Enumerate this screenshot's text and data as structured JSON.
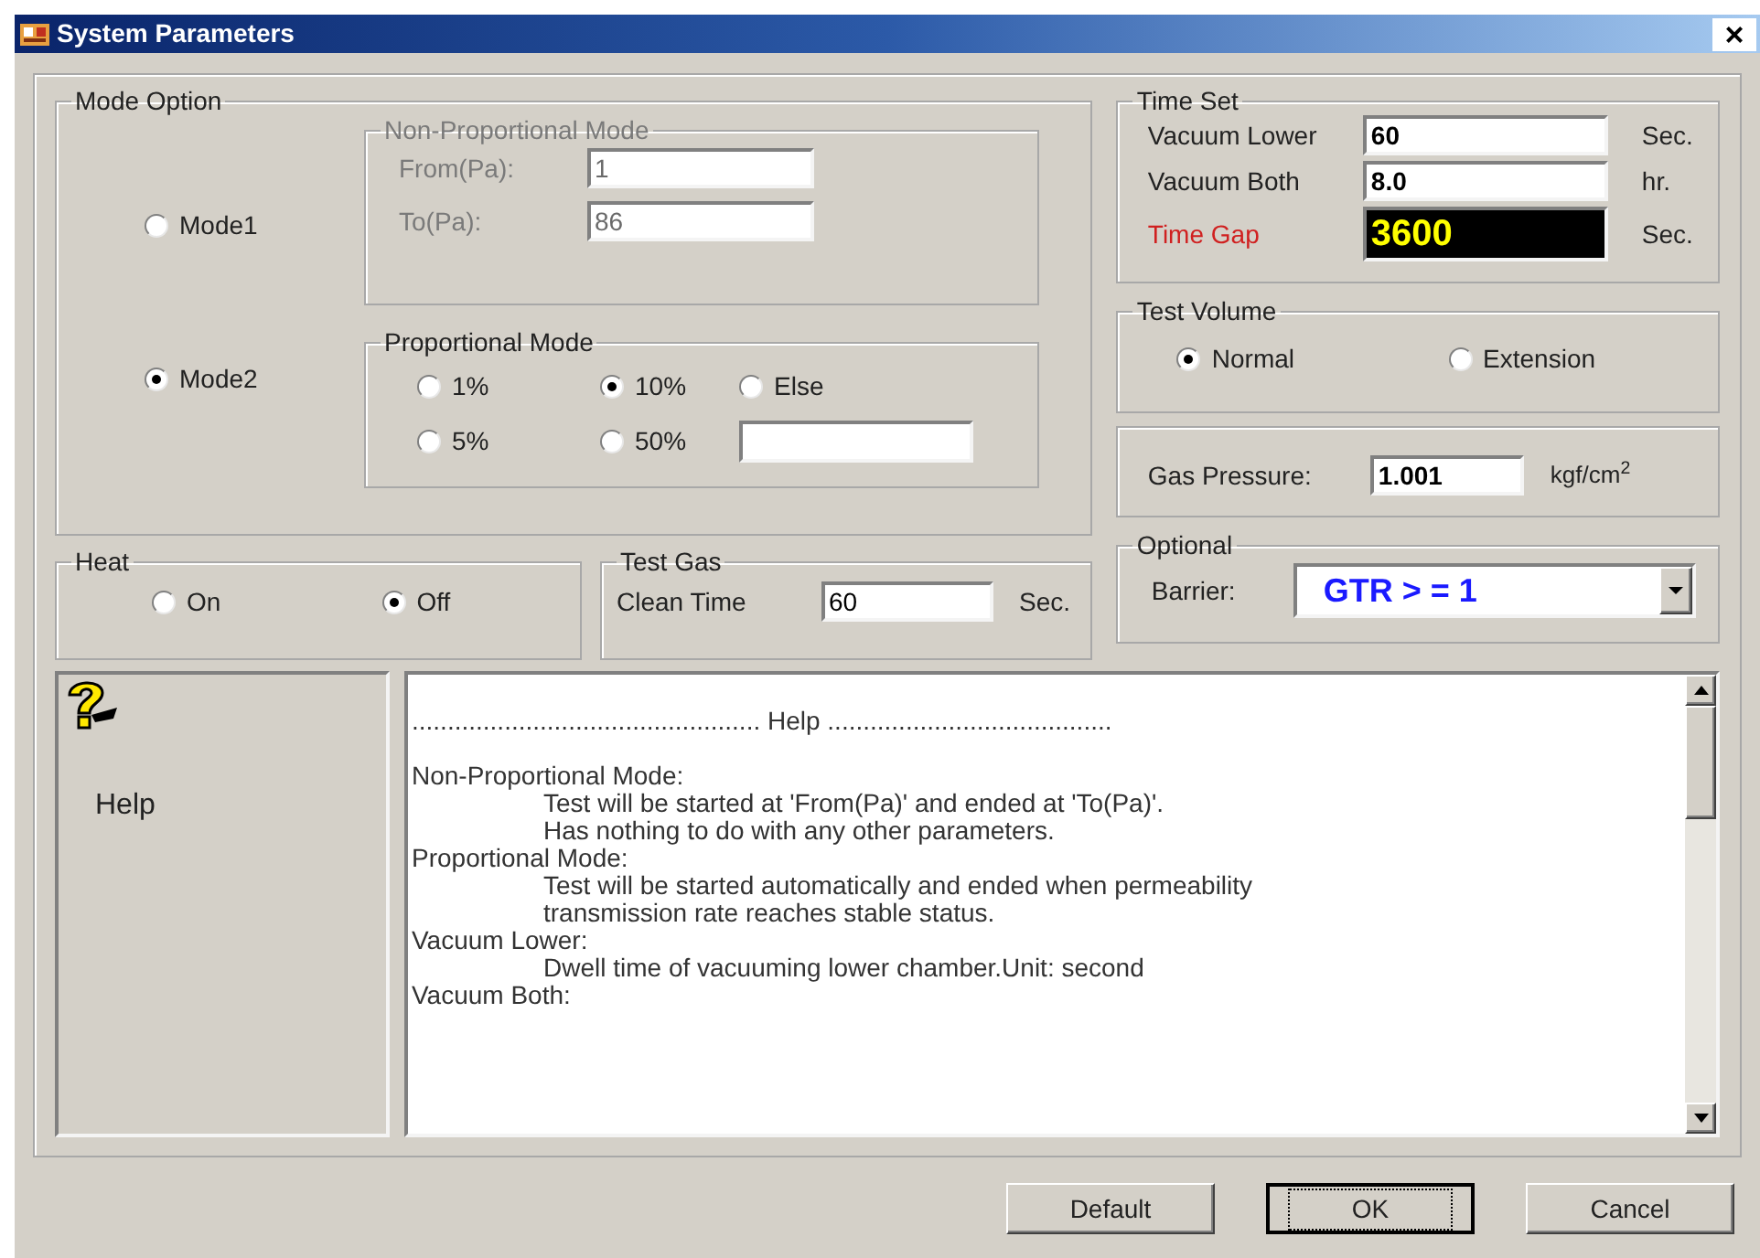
{
  "window": {
    "title": "System Parameters",
    "close": "×"
  },
  "mode_option": {
    "title": "Mode Option",
    "modes": [
      {
        "label": "Mode1",
        "selected": false
      },
      {
        "label": "Mode2",
        "selected": true
      }
    ],
    "non_proportional": {
      "title": "Non-Proportional Mode",
      "disabled": true,
      "fields": [
        {
          "label": "From(Pa):",
          "value": "1"
        },
        {
          "label": "To(Pa):",
          "value": "86"
        }
      ]
    },
    "proportional": {
      "title": "Proportional Mode",
      "options": [
        {
          "label": "1%",
          "selected": false
        },
        {
          "label": "10%",
          "selected": true
        },
        {
          "label": "Else",
          "selected": false
        },
        {
          "label": "5%",
          "selected": false
        },
        {
          "label": "50%",
          "selected": false
        }
      ]
    }
  },
  "heat": {
    "title": "Heat",
    "options": [
      {
        "label": "On",
        "selected": false
      },
      {
        "label": "Off",
        "selected": true
      }
    ]
  },
  "test_gas": {
    "title": "Test Gas",
    "label": "Clean Time",
    "value": "60",
    "unit": "Sec."
  },
  "time_set": {
    "title": "Time Set",
    "rows": [
      {
        "label": "Vacuum Lower",
        "value": "60",
        "unit": "Sec.",
        "kind": "input"
      },
      {
        "label": "Vacuum Both",
        "value": "8.0",
        "unit": "hr.",
        "kind": "input"
      },
      {
        "label": "Time Gap",
        "value": "3600",
        "unit": "Sec.",
        "kind": "display"
      }
    ]
  },
  "test_volume": {
    "title": "Test Volume",
    "options": [
      {
        "label": "Normal",
        "selected": true
      },
      {
        "label": "Extension",
        "selected": false
      }
    ]
  },
  "gas_pressure": {
    "label": "Gas Pressure:",
    "value": "1.001",
    "unit": "kgf/cm$^{2}$"
  },
  "optional": {
    "title": "Optional",
    "label": "Barrier:",
    "value": "GTR > = 1"
  },
  "help": {
    "label": "Help",
    "lines": [
      {
        "kind": "heading",
        "text": "................................................. Help ........................................"
      },
      {
        "kind": "topic",
        "text": "Non-Proportional Mode:"
      },
      {
        "kind": "detail",
        "text": "Test will be started at 'From(Pa)' and ended at 'To(Pa)'."
      },
      {
        "kind": "detail",
        "text": "Has nothing to do with any other parameters."
      },
      {
        "kind": "topic",
        "text": "Proportional Mode:"
      },
      {
        "kind": "detail",
        "text": "Test will be started automatically and ended when permeability"
      },
      {
        "kind": "detail",
        "text": "transmission rate reaches stable status."
      },
      {
        "kind": "topic",
        "text": "Vacuum Lower:"
      },
      {
        "kind": "detail",
        "text": "Dwell time of vacuuming lower chamber.Unit: second"
      },
      {
        "kind": "topic",
        "text": "Vacuum Both:"
      }
    ]
  },
  "buttons": [
    {
      "label": "Default",
      "focused": false
    },
    {
      "label": "OK",
      "focused": true
    },
    {
      "label": "Cancel",
      "focused": false
    }
  ]
}
